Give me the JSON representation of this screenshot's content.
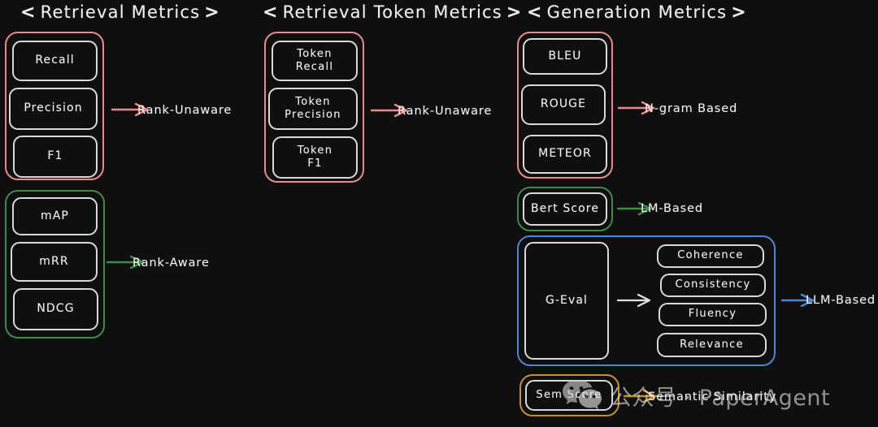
{
  "page": {
    "background_color": "#100f10",
    "style": "hand-drawn whiteboard diagram"
  },
  "colors": {
    "red": "#eb8a8a",
    "green": "#3f8a45",
    "blue": "#4a87d6",
    "orange": "#c8902a",
    "box_border": "#d8d8d8",
    "text": "#f2f2f2"
  },
  "columns": [
    {
      "id": "retrieval-metrics",
      "title": "Retrieval Metrics",
      "bracket_left": "<",
      "bracket_right": ">"
    },
    {
      "id": "retrieval-token-metrics",
      "title": "Retrieval Token Metrics",
      "bracket_left": "<",
      "bracket_right": ">"
    },
    {
      "id": "generation-metrics",
      "title": "Generation Metrics",
      "bracket_left": "<",
      "bracket_right": ">"
    }
  ],
  "groups": {
    "retrieval_rank_unaware": {
      "color": "red",
      "label": "Rank-Unaware",
      "items": [
        "Recall",
        "Precision",
        "F1"
      ]
    },
    "retrieval_rank_aware": {
      "color": "green",
      "label": "Rank-Aware",
      "items": [
        "mAP",
        "mRR",
        "NDCG"
      ]
    },
    "token_rank_unaware": {
      "color": "red",
      "label": "Rank-Unaware",
      "items": [
        "Token\nRecall",
        "Token\nPrecision",
        "Token\nF1"
      ]
    },
    "generation_ngram": {
      "color": "red",
      "label": "N-gram Based",
      "items": [
        "BLEU",
        "ROUGE",
        "METEOR"
      ]
    },
    "generation_lm": {
      "color": "green",
      "label": "LM-Based",
      "items": [
        "Bert Score"
      ]
    },
    "generation_llm": {
      "color": "blue",
      "label": "LLM-Based",
      "primary": "G-Eval",
      "items": [
        "Coherence",
        "Consistency",
        "Fluency",
        "Relevance"
      ]
    },
    "generation_semantic": {
      "color": "orange",
      "label": "Semantic Similarity",
      "items": [
        "Sem Score"
      ]
    }
  },
  "boxes": {
    "recall": "Recall",
    "precision": "Precision",
    "f1": "F1",
    "map": "mAP",
    "mrr": "mRR",
    "ndcg": "NDCG",
    "token_recall_l1": "Token",
    "token_recall_l2": "Recall",
    "token_precision_l1": "Token",
    "token_precision_l2": "Precision",
    "token_f1_l1": "Token",
    "token_f1_l2": "F1",
    "bleu": "BLEU",
    "rouge": "ROUGE",
    "meteor": "METEOR",
    "bert_score": "Bert Score",
    "g_eval": "G-Eval",
    "coherence": "Coherence",
    "consistency": "Consistency",
    "fluency": "Fluency",
    "relevance": "Relevance",
    "sem_score": "Sem Score"
  },
  "arrow_labels": {
    "rank_unaware_1": "Rank-Unaware",
    "rank_unaware_2": "Rank-Unaware",
    "rank_aware": "Rank-Aware",
    "ngram_based": "N-gram Based",
    "lm_based": "LM-Based",
    "llm_based": "LLM-Based",
    "semantic_similarity": "Semantic Similarity"
  },
  "watermark": {
    "text": "公众号 · PaperAgent",
    "logo": "wechat-icon"
  }
}
